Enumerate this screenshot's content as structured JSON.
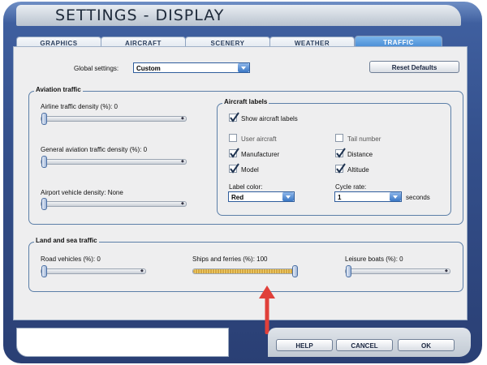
{
  "window": {
    "title": "SETTINGS - DISPLAY"
  },
  "tabs": [
    {
      "label": "GRAPHICS",
      "active": false
    },
    {
      "label": "AIRCRAFT",
      "active": false
    },
    {
      "label": "SCENERY",
      "active": false
    },
    {
      "label": "WEATHER",
      "active": false
    },
    {
      "label": "TRAFFIC",
      "active": true
    }
  ],
  "global": {
    "label": "Global settings:",
    "value": "Custom",
    "reset_label": "Reset Defaults"
  },
  "aviation": {
    "title": "Aviation traffic",
    "airline": {
      "label": "Airline traffic density (%): 0",
      "value": 0
    },
    "general": {
      "label": "General aviation traffic density (%): 0",
      "value": 0
    },
    "vehicle": {
      "label": "Airport vehicle density: None",
      "value": 0
    }
  },
  "labels": {
    "title": "Aircraft labels",
    "show": {
      "label": "Show aircraft labels",
      "checked": true
    },
    "user_aircraft": {
      "label": "User aircraft",
      "checked": false
    },
    "tail_number": {
      "label": "Tail number",
      "checked": false
    },
    "manufacturer": {
      "label": "Manufacturer",
      "checked": true
    },
    "distance": {
      "label": "Distance",
      "checked": true
    },
    "model": {
      "label": "Model",
      "checked": true
    },
    "altitude": {
      "label": "Altitude",
      "checked": true
    },
    "color": {
      "label": "Label color:",
      "value": "Red"
    },
    "cycle": {
      "label": "Cycle rate:",
      "value": "1",
      "unit": "seconds"
    }
  },
  "land_sea": {
    "title": "Land and sea traffic",
    "road": {
      "label": "Road vehicles (%): 0",
      "value": 0
    },
    "ships": {
      "label": "Ships and ferries (%): 100",
      "value": 100
    },
    "leisure": {
      "label": "Leisure boats (%): 0",
      "value": 0
    }
  },
  "buttons": {
    "help": "HELP",
    "cancel": "CANCEL",
    "ok": "OK"
  },
  "colors": {
    "frame": "#34508c",
    "active_tab": "#3f85d2",
    "arrow": "#e0403a",
    "slider_fill": "#d4a640"
  }
}
